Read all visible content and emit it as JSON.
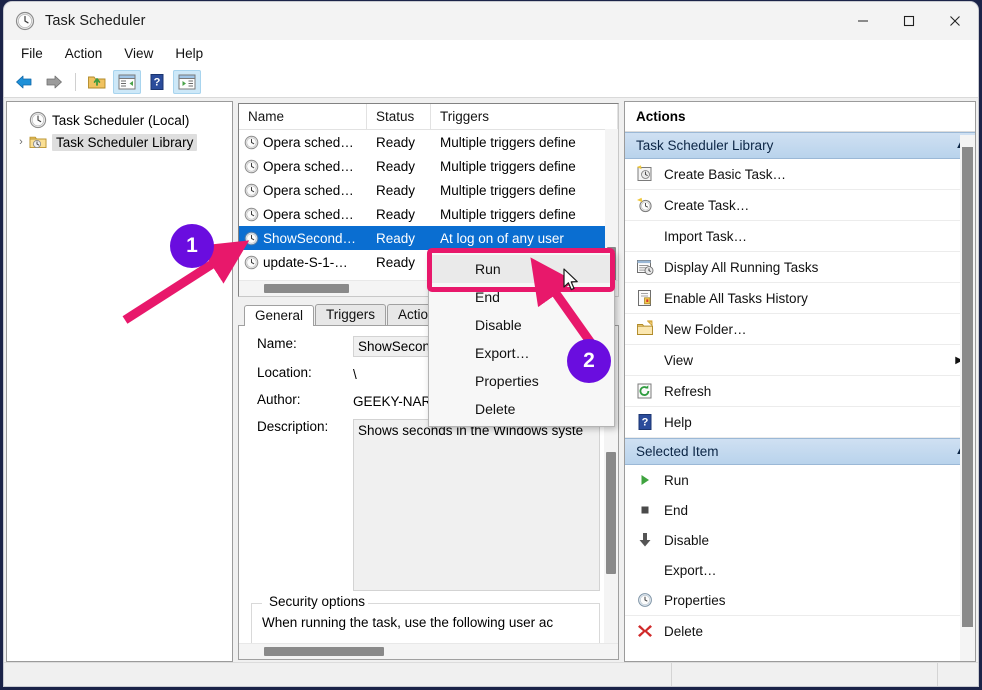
{
  "window": {
    "title": "Task Scheduler",
    "app_icon": "clock-icon",
    "minimize_glyph": "─",
    "maximize_glyph": "□",
    "close_glyph": "✕"
  },
  "menubar": {
    "items": [
      {
        "label": "File"
      },
      {
        "label": "Action"
      },
      {
        "label": "View"
      },
      {
        "label": "Help"
      }
    ]
  },
  "toolbar": {
    "buttons": [
      {
        "name": "back-icon"
      },
      {
        "name": "forward-icon"
      },
      {
        "name": "up-one-level-icon"
      },
      {
        "name": "show-hide-console-tree-icon"
      },
      {
        "name": "help-icon"
      },
      {
        "name": "show-hide-action-pane-icon"
      }
    ]
  },
  "tree": {
    "items": [
      {
        "label": "Task Scheduler (Local)",
        "icon": "clock-icon",
        "level": 1,
        "expandable": false,
        "selected": false
      },
      {
        "label": "Task Scheduler Library",
        "icon": "folder-clock-icon",
        "level": 2,
        "expandable": true,
        "selected": true
      }
    ]
  },
  "task_list": {
    "columns": [
      "Name",
      "Status",
      "Triggers"
    ],
    "rows": [
      {
        "name": "Opera sched…",
        "status": "Ready",
        "triggers": "Multiple triggers define",
        "selected": false
      },
      {
        "name": "Opera sched…",
        "status": "Ready",
        "triggers": "Multiple triggers define",
        "selected": false
      },
      {
        "name": "Opera sched…",
        "status": "Ready",
        "triggers": "Multiple triggers define",
        "selected": false
      },
      {
        "name": "Opera sched…",
        "status": "Ready",
        "triggers": "Multiple triggers define",
        "selected": false
      },
      {
        "name": "ShowSecond…",
        "status": "Ready",
        "triggers": "At log on of any user",
        "selected": true
      },
      {
        "name": "update-S-1-…",
        "status": "Ready",
        "triggers": "",
        "selected": false
      }
    ]
  },
  "detail": {
    "tabs": [
      {
        "label": "General",
        "active": true
      },
      {
        "label": "Triggers",
        "active": false
      },
      {
        "label": "Actions",
        "active": false
      }
    ],
    "fields": [
      {
        "label": "Name:",
        "value": "ShowSecond",
        "type": "box"
      },
      {
        "label": "Location:",
        "value": "\\",
        "type": "plain"
      },
      {
        "label": "Author:",
        "value": "GEEKY-NARENS-MS\\naren",
        "type": "plain"
      },
      {
        "label": "Description:",
        "value": "Shows seconds in the Windows syste",
        "type": "textarea"
      }
    ],
    "security_group": {
      "title": "Security options",
      "text": "When running the task, use the following user ac"
    }
  },
  "context_menu": {
    "items": [
      {
        "label": "Run",
        "highlighted": true
      },
      {
        "label": "End",
        "highlighted": false
      },
      {
        "label": "Disable",
        "highlighted": false
      },
      {
        "label": "Export…",
        "highlighted": false
      },
      {
        "label": "Properties",
        "highlighted": false
      },
      {
        "label": "Delete",
        "highlighted": false
      }
    ]
  },
  "actions_pane": {
    "title": "Actions",
    "groups": [
      {
        "header": "Task Scheduler Library",
        "collapsed": false,
        "items": [
          {
            "label": "Create Basic Task…",
            "icon": "create-basic-task-icon",
            "submenu": false
          },
          {
            "label": "Create Task…",
            "icon": "create-task-icon",
            "submenu": false
          },
          {
            "label": "Import Task…",
            "icon": "none",
            "submenu": false
          },
          {
            "label": "Display All Running Tasks",
            "icon": "running-tasks-icon",
            "submenu": false
          },
          {
            "label": "Enable All Tasks History",
            "icon": "history-icon",
            "submenu": false
          },
          {
            "label": "New Folder…",
            "icon": "new-folder-icon",
            "submenu": false
          },
          {
            "label": "View",
            "icon": "none",
            "submenu": true
          },
          {
            "label": "Refresh",
            "icon": "refresh-icon",
            "submenu": false
          },
          {
            "label": "Help",
            "icon": "help-icon",
            "submenu": false
          }
        ]
      },
      {
        "header": "Selected Item",
        "collapsed": false,
        "items": [
          {
            "label": "Run",
            "icon": "run-play-icon",
            "submenu": false
          },
          {
            "label": "End",
            "icon": "stop-square-icon",
            "submenu": false
          },
          {
            "label": "Disable",
            "icon": "down-arrow-icon",
            "submenu": false
          },
          {
            "label": "Export…",
            "icon": "none",
            "submenu": false
          },
          {
            "label": "Properties",
            "icon": "clock-icon",
            "submenu": false
          },
          {
            "label": "Delete",
            "icon": "red-x-icon",
            "submenu": false
          }
        ]
      }
    ],
    "submenu_arrow_glyph": "▶",
    "collapse_caret_glyph": "▲"
  },
  "annotations": {
    "badges": [
      {
        "id": "1",
        "label": "1"
      },
      {
        "id": "2",
        "label": "2"
      }
    ],
    "badge_color": "#6A0DDF",
    "arrow_color": "#E8186B",
    "highlight_color": "#E8186B"
  }
}
